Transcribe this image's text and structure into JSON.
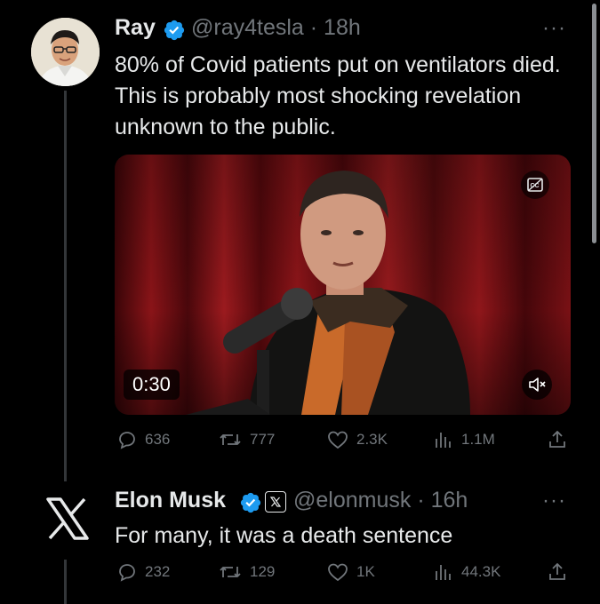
{
  "tweets": [
    {
      "name": "Ray",
      "handle": "@ray4tesla",
      "time": "18h",
      "text": "80% of Covid patients put on ventilators died. This is probably most shocking revelation unknown to the public.",
      "video": {
        "duration": "0:30"
      },
      "stats": {
        "replies": "636",
        "reposts": "777",
        "likes": "2.3K",
        "views": "1.1M"
      }
    },
    {
      "name": "Elon Musk",
      "handle": "@elonmusk",
      "time": "16h",
      "text": "For many, it was a death sentence",
      "stats": {
        "replies": "232",
        "reposts": "129",
        "likes": "1K",
        "views": "44.3K"
      }
    }
  ],
  "colors": {
    "background": "#000000",
    "text": "#e7e9ea",
    "muted": "#71767b",
    "verified": "#1d9bf0"
  },
  "icons": [
    "verified-badge-icon",
    "more-icon",
    "captions-icon",
    "mute-icon",
    "reply-icon",
    "repost-icon",
    "like-icon",
    "views-icon",
    "share-icon",
    "x-logo-icon",
    "affiliate-badge-icon"
  ]
}
